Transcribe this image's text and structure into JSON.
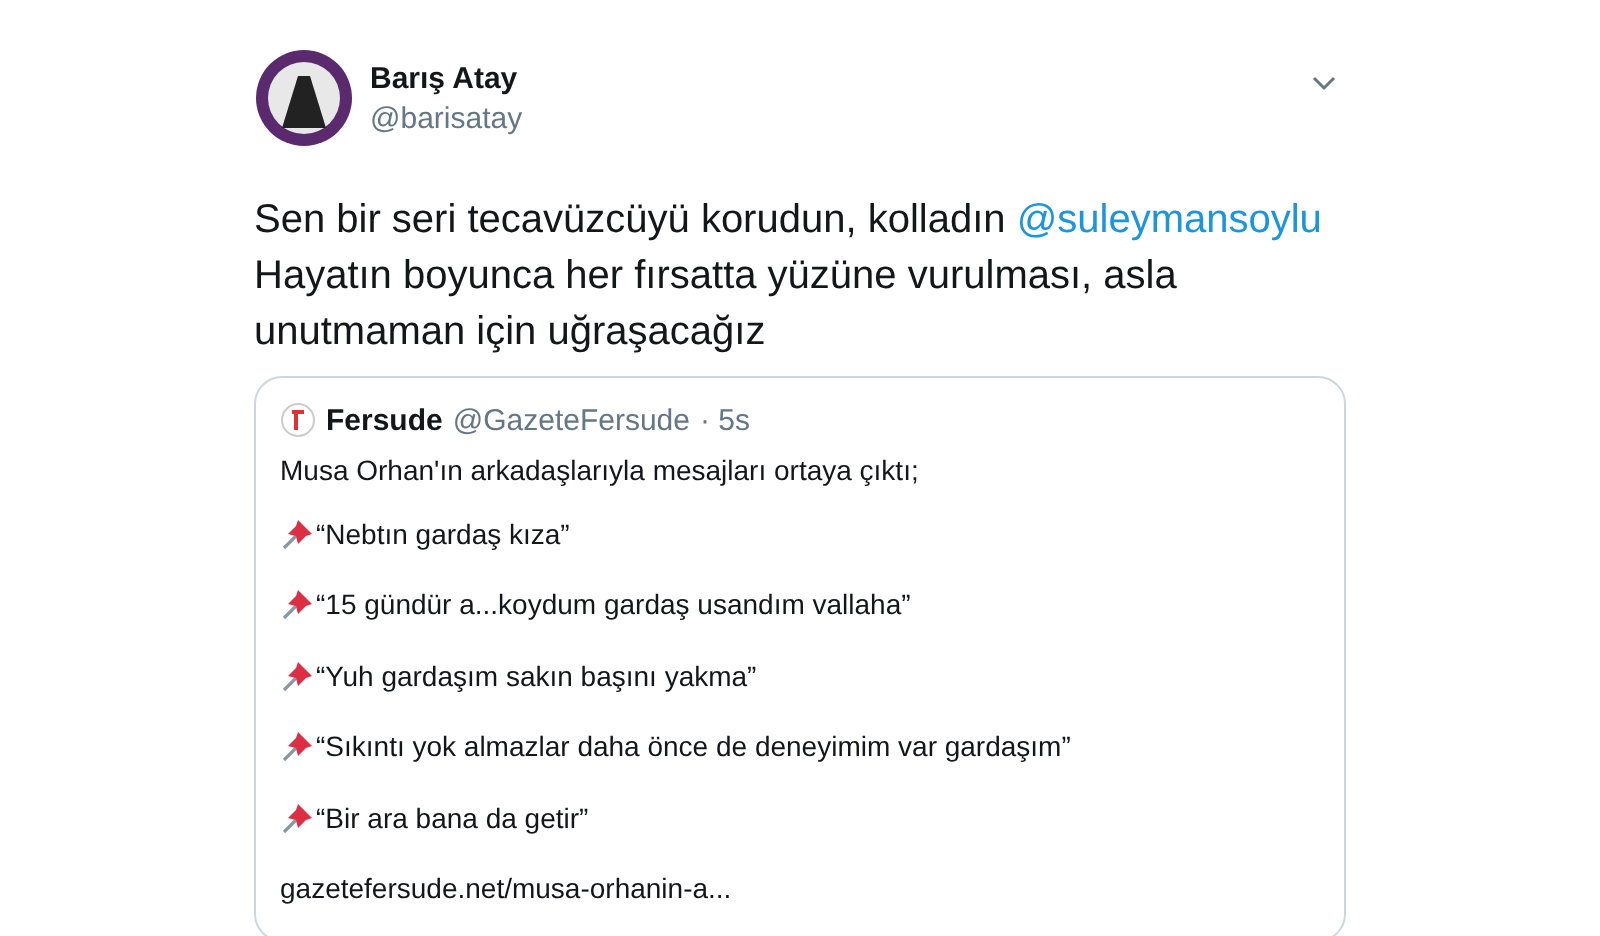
{
  "tweet": {
    "name": "Barış Atay",
    "handle": "@barisatay",
    "body": [
      {
        "kind": "text",
        "text": "Sen bir seri tecavüzcüyü korudun, kolladın "
      },
      {
        "kind": "mention",
        "text": "@suleymansoylu"
      },
      {
        "kind": "text",
        "text": " Hayatın boyunca her fırsatta yüzüne vurulması, asla unutmaman için uğraşacağız"
      }
    ]
  },
  "quote": {
    "name": "Fersude",
    "handle": "@GazeteFersude",
    "time": "· 5s",
    "lines": [
      {
        "kind": "plain",
        "text": "Musa Orhan'ın arkadaşlarıyla mesajları ortaya çıktı;"
      },
      {
        "kind": "pinned",
        "text": "“Nebtın gardaş kıza”"
      },
      {
        "kind": "pinned",
        "text": "“15 gündür a...koydum gardaş usandım vallaha”"
      },
      {
        "kind": "pinned",
        "text": "“Yuh gardaşım sakın başını yakma”"
      },
      {
        "kind": "pinned",
        "text": "“Sıkıntı yok almazlar daha önce de deneyimim var gardaşım”"
      },
      {
        "kind": "pinned",
        "text": "“Bir ara bana da getir”"
      },
      {
        "kind": "plain",
        "text": "gazetefersude.net/musa-orhanin-a..."
      }
    ]
  }
}
